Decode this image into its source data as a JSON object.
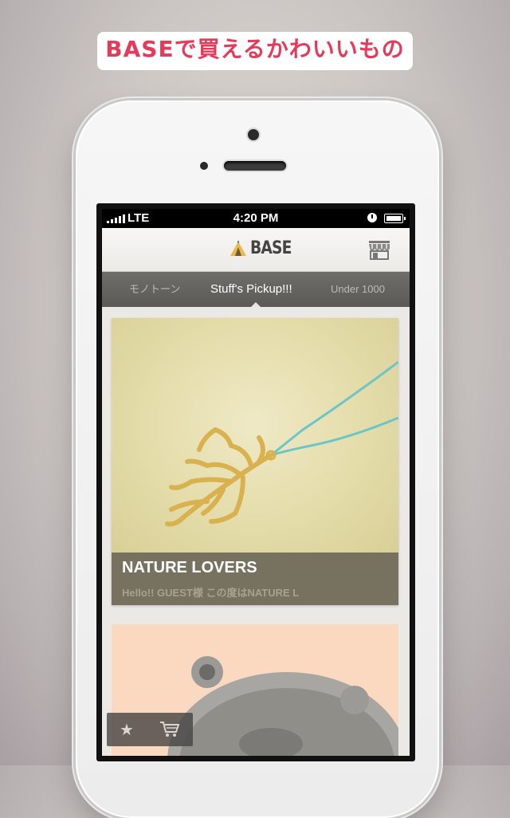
{
  "headline": "BASEで買えるかわいいもの",
  "status_bar": {
    "carrier": "LTE",
    "time": "4:20 PM",
    "icons": [
      "signal-icon",
      "clock-icon",
      "battery-icon"
    ]
  },
  "app_bar": {
    "logo_text": "BASE",
    "logo_icon": "tent-icon",
    "shop_icon": "storefront-icon"
  },
  "tabs": [
    {
      "label": "モノトーン",
      "active": false
    },
    {
      "label": "Stuff's Pickup!!!",
      "active": true
    },
    {
      "label": "Under 1000",
      "active": false
    }
  ],
  "cards": [
    {
      "title": "NATURE LOVERS",
      "subtitle": "Hello!! GUEST様 この度はNATURE L",
      "image": "gold-coral-pendant-necklace"
    },
    {
      "title": "",
      "subtitle": "",
      "image": "fluffy-bear-plush"
    }
  ],
  "floating_bar": {
    "icons": [
      "star-icon",
      "cart-icon"
    ]
  },
  "colors": {
    "headline_text": "#e53a5a",
    "caption_bg": "#77725f",
    "tabs_bg": "#66645f"
  }
}
